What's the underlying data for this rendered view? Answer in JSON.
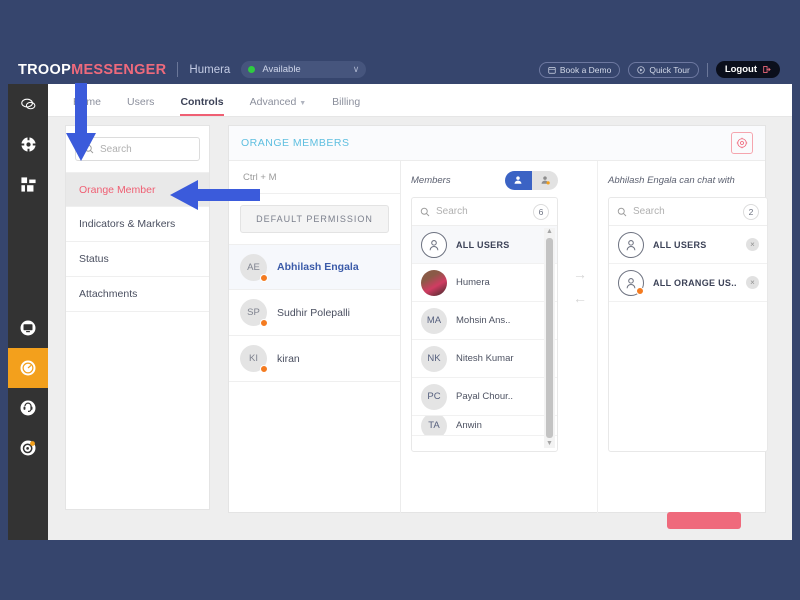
{
  "brand": {
    "logo_part1": "TROOP",
    "logo_part2": "MESSENGER",
    "username": "Humera",
    "status_label": "Available",
    "status_color": "#2ecc40",
    "caret": "∨"
  },
  "header_actions": {
    "book_demo": "Book a Demo",
    "quick_tour": "Quick Tour",
    "logout": "Logout"
  },
  "rail": {
    "items": [
      {
        "name": "chat-icon",
        "selected": false
      },
      {
        "name": "contacts-icon",
        "selected": false
      },
      {
        "name": "apps-icon",
        "selected": false
      },
      {
        "name": "monitor-icon",
        "selected": false
      },
      {
        "name": "dashboard-icon",
        "selected": true
      },
      {
        "name": "support-icon",
        "selected": false
      },
      {
        "name": "settings-icon",
        "selected": false
      }
    ]
  },
  "tabs": [
    {
      "label": "Home",
      "active": false,
      "dropdown": false
    },
    {
      "label": "Users",
      "active": false,
      "dropdown": false
    },
    {
      "label": "Controls",
      "active": true,
      "dropdown": false
    },
    {
      "label": "Advanced",
      "active": false,
      "dropdown": true
    },
    {
      "label": "Billing",
      "active": false,
      "dropdown": false
    }
  ],
  "sidebar": {
    "search_placeholder": "Search",
    "items": [
      {
        "label": "Orange Member",
        "active": true
      },
      {
        "label": "Indicators & Markers",
        "active": false
      },
      {
        "label": "Status",
        "active": false
      },
      {
        "label": "Attachments",
        "active": false
      }
    ]
  },
  "main": {
    "title": "ORANGE MEMBERS",
    "gear_icon": "gear-icon",
    "shortcut_hint": "Ctrl + M",
    "default_permission": "DEFAULT PERMISSION",
    "members": [
      {
        "initials": "AE",
        "name": "Abhilash Engala",
        "selected": true,
        "presence": "#f47b20"
      },
      {
        "initials": "SP",
        "name": "Sudhir Polepalli",
        "selected": false,
        "presence": "#f47b20"
      },
      {
        "initials": "KI",
        "name": "kiran",
        "selected": false,
        "presence": "#f47b20"
      }
    ]
  },
  "members_panel": {
    "label": "Members",
    "search_placeholder": "Search",
    "count": "6",
    "toggle": [
      {
        "name": "user-icon",
        "active": true
      },
      {
        "name": "orange-user-icon",
        "active": false
      }
    ],
    "rows": [
      {
        "avatar": "ring",
        "initials": "",
        "name": "ALL USERS",
        "bold": true,
        "highlight": true,
        "presence": false
      },
      {
        "avatar": "photo",
        "initials": "",
        "name": "Humera",
        "bold": false,
        "highlight": false,
        "presence": false
      },
      {
        "avatar": "grey",
        "initials": "MA",
        "name": "Mohsin Ans..",
        "bold": false,
        "highlight": false,
        "presence": false
      },
      {
        "avatar": "grey",
        "initials": "NK",
        "name": "Nitesh Kumar",
        "bold": false,
        "highlight": false,
        "presence": false
      },
      {
        "avatar": "grey",
        "initials": "PC",
        "name": "Payal Chour..",
        "bold": false,
        "highlight": false,
        "presence": false
      },
      {
        "avatar": "grey",
        "initials": "TA",
        "name": "Anwin",
        "bold": false,
        "highlight": false,
        "presence": false
      }
    ]
  },
  "chat_panel": {
    "label": "Abhilash Engala can chat with",
    "search_placeholder": "Search",
    "count": "2",
    "rows": [
      {
        "avatar": "ring",
        "name": "ALL USERS",
        "presence": false,
        "remove": "×"
      },
      {
        "avatar": "ring",
        "name": "ALL ORANGE US..",
        "presence": true,
        "remove": "×"
      }
    ]
  },
  "transfer": {
    "add_arrow": "→",
    "remove_arrow": "←"
  },
  "save_button": {
    "label": "",
    "color": "#ef6a7c"
  },
  "annotations": [
    {
      "name": "annotation-arrow-down",
      "color": "#3b5bdb",
      "direction": "down"
    },
    {
      "name": "annotation-arrow-left",
      "color": "#3b5bdb",
      "direction": "left"
    }
  ]
}
